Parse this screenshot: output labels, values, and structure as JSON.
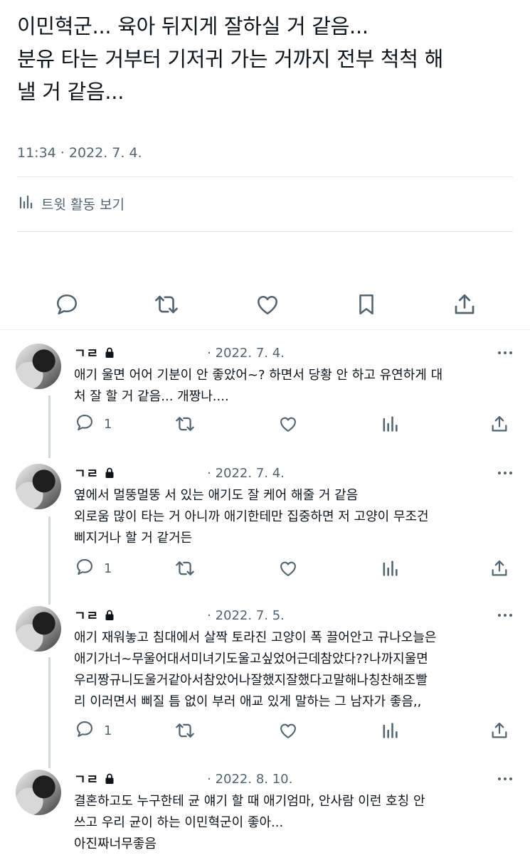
{
  "main_tweet": {
    "lines": [
      "이민혁군... 육아 뒤지게 잘하실 거 같음...",
      "분유 타는 거부터 기저귀 가는 거까지 전부 척척 해",
      "낼 거 같음..."
    ],
    "timestamp": "11:34 · 2022. 7. 4.",
    "activity_label": "트윗 활동 보기"
  },
  "icons": {
    "reply": "reply-icon",
    "retweet": "retweet-icon",
    "like": "heart-icon",
    "bookmark": "bookmark-icon",
    "share": "share-icon",
    "analytics": "analytics-icon",
    "lock": "lock-icon",
    "more": "more-icon"
  },
  "colors": {
    "secondary_text": "#536471",
    "divider": "#e6e9ea",
    "thread_line": "#cfd9de"
  },
  "replies": [
    {
      "name": "ㄱㄹ",
      "date": "· 2022. 7. 4.",
      "lines": [
        "애기 울면 어어 기분이 안 좋았어~? 하면서 당황 안 하고 유연하게 대",
        "처 잘 할 거 같음... 개짱나...."
      ],
      "reply_count": "1"
    },
    {
      "name": "ㄱㄹ",
      "date": "· 2022. 7. 4.",
      "lines": [
        "옆에서 멀뚱멀뚱 서 있는 애기도 잘 케어 해줄 거 같음",
        "외로움 많이 타는 거 아니까 애기한테만 집중하면 저 고양이 무조건",
        "삐지거나 할 거 같거든"
      ],
      "reply_count": "1"
    },
    {
      "name": "ㄱㄹ",
      "date": "· 2022. 7. 5.",
      "lines": [
        "애기 재워놓고 침대에서 살짝 토라진 고양이 폭 끌어안고 규나오늘은",
        "애기가너~무울어대서미녀기도울고싶었어근데참았다??나까지울면",
        "우리짱규니도울거같아서참았어나잘했지잘했다고말해나칭찬해조빨",
        "리 이러면서 삐질 틈 없이 부러 애교 있게 말하는 그 남자가 좋음,,"
      ],
      "reply_count": "1"
    },
    {
      "name": "ㄱㄹ",
      "date": "· 2022. 8. 10.",
      "lines": [
        "결혼하고도 누구한테 균 얘기 할 때 애기엄마, 안사람 이런 호칭 안",
        "쓰고 우리 균이 하는 이민혁군이 좋아...",
        "아진짜너무좋음"
      ],
      "reply_count": ""
    }
  ]
}
